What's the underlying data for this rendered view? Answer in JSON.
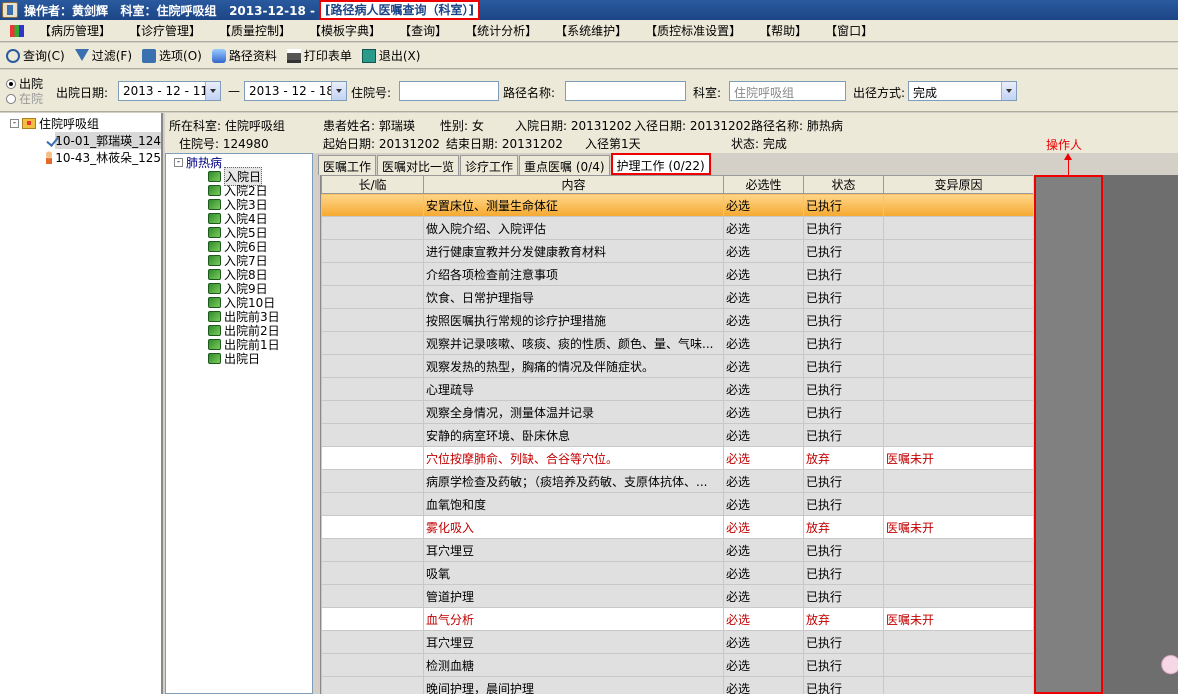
{
  "title": {
    "text": "操作者：黄剑辉   科室：住院呼吸组   2013-12-18 -",
    "highlight": "[路径病人医嘱查询（科室）]"
  },
  "menu": [
    "【病历管理】",
    "【诊疗管理】",
    "【质量控制】",
    "【模板字典】",
    "【查询】",
    "【统计分析】",
    "【系统维护】",
    "【质控标准设置】",
    "【帮助】",
    "【窗口】"
  ],
  "toolbar": {
    "query": "查询(C)",
    "filter": "过滤(F)",
    "options": "选项(O)",
    "path_data": "路径资料",
    "print": "打印表单",
    "exit": "退出(X)"
  },
  "filter": {
    "radio_discharged": "出院",
    "radio_inpatient": "在院",
    "discharge_date_label": "出院日期:",
    "date_from": "2013 - 12 - 11",
    "date_sep": "—",
    "date_to": "2013 - 12 - 18",
    "admission_no_label": "住院号:",
    "admission_no_value": "",
    "path_name_label": "路径名称:",
    "path_name_value": "",
    "dept_label": "科室:",
    "dept_value": "住院呼吸组",
    "exit_mode_label": "出径方式:",
    "exit_mode_value": "完成"
  },
  "left_tree": {
    "root": "住院呼吸组",
    "root_expander": "-",
    "patients": [
      "10-01_郭瑞瑛_124",
      "10-43_林莜朵_125"
    ]
  },
  "patient_info": {
    "dept": "所在科室: 住院呼吸组",
    "name": "患者姓名: 郭瑞瑛",
    "sex": "性别: 女",
    "admit_date": "入院日期: 20131202",
    "enter_path_date": "入径日期: 20131202",
    "path_name": "路径名称: 肺热病",
    "admission_no": "住院号: 124980",
    "start_date": "起始日期: 20131202",
    "end_date": "结束日期: 20131202",
    "enter_day": "入径第1天",
    "status": "状态: 完成"
  },
  "day_tree": {
    "root": "肺热病",
    "root_expander": "-",
    "days": [
      "入院日",
      "入院2日",
      "入院3日",
      "入院4日",
      "入院5日",
      "入院6日",
      "入院7日",
      "入院8日",
      "入院9日",
      "入院10日",
      "出院前3日",
      "出院前2日",
      "出院前1日",
      "出院日"
    ]
  },
  "tabs": [
    "医嘱工作",
    "医嘱对比一览",
    "诊疗工作",
    "重点医嘱 (0/4)",
    "护理工作 (0/22)"
  ],
  "table": {
    "headers": [
      "长/临",
      "内容",
      "必选性",
      "状态",
      "变异原因"
    ],
    "rows": [
      {
        "content": "安置床位、测量生命体征",
        "required": "必选",
        "status": "已执行",
        "reason": ""
      },
      {
        "content": "做入院介绍、入院评估",
        "required": "必选",
        "status": "已执行",
        "reason": ""
      },
      {
        "content": "进行健康宣教并分发健康教育材料",
        "required": "必选",
        "status": "已执行",
        "reason": ""
      },
      {
        "content": "介绍各项检查前注意事项",
        "required": "必选",
        "status": "已执行",
        "reason": ""
      },
      {
        "content": "饮食、日常护理指导",
        "required": "必选",
        "status": "已执行",
        "reason": ""
      },
      {
        "content": "按照医嘱执行常规的诊疗护理措施",
        "required": "必选",
        "status": "已执行",
        "reason": ""
      },
      {
        "content": "观察并记录咳嗽、咳痰、痰的性质、颜色、量、气味...",
        "required": "必选",
        "status": "已执行",
        "reason": ""
      },
      {
        "content": "观察发热的热型，胸痛的情况及伴随症状。",
        "required": "必选",
        "status": "已执行",
        "reason": ""
      },
      {
        "content": "心理疏导",
        "required": "必选",
        "status": "已执行",
        "reason": ""
      },
      {
        "content": "观察全身情况，测量体温并记录",
        "required": "必选",
        "status": "已执行",
        "reason": ""
      },
      {
        "content": "安静的病室环境、卧床休息",
        "required": "必选",
        "status": "已执行",
        "reason": ""
      },
      {
        "content": "穴位按摩肺俞、列缺、合谷等穴位。",
        "required": "必选",
        "status": "放弃",
        "reason": "医嘱未开"
      },
      {
        "content": "病原学检查及药敏；（痰培养及药敏、支原体抗体、...",
        "required": "必选",
        "status": "已执行",
        "reason": ""
      },
      {
        "content": "血氧饱和度",
        "required": "必选",
        "status": "已执行",
        "reason": ""
      },
      {
        "content": "雾化吸入",
        "required": "必选",
        "status": "放弃",
        "reason": "医嘱未开"
      },
      {
        "content": "耳穴埋豆",
        "required": "必选",
        "status": "已执行",
        "reason": ""
      },
      {
        "content": "吸氧",
        "required": "必选",
        "status": "已执行",
        "reason": ""
      },
      {
        "content": "管道护理",
        "required": "必选",
        "status": "已执行",
        "reason": ""
      },
      {
        "content": "血气分析",
        "required": "必选",
        "status": "放弃",
        "reason": "医嘱未开"
      },
      {
        "content": "耳穴埋豆",
        "required": "必选",
        "status": "已执行",
        "reason": ""
      },
      {
        "content": "检测血糖",
        "required": "必选",
        "status": "已执行",
        "reason": ""
      },
      {
        "content": "晚间护理，晨间护理",
        "required": "必选",
        "status": "已执行",
        "reason": ""
      }
    ]
  },
  "annotation": "操作人",
  "colors": {
    "highlight_red": "#e00000",
    "abandon_text": "#c00000",
    "selected_row": "#f5a930"
  }
}
